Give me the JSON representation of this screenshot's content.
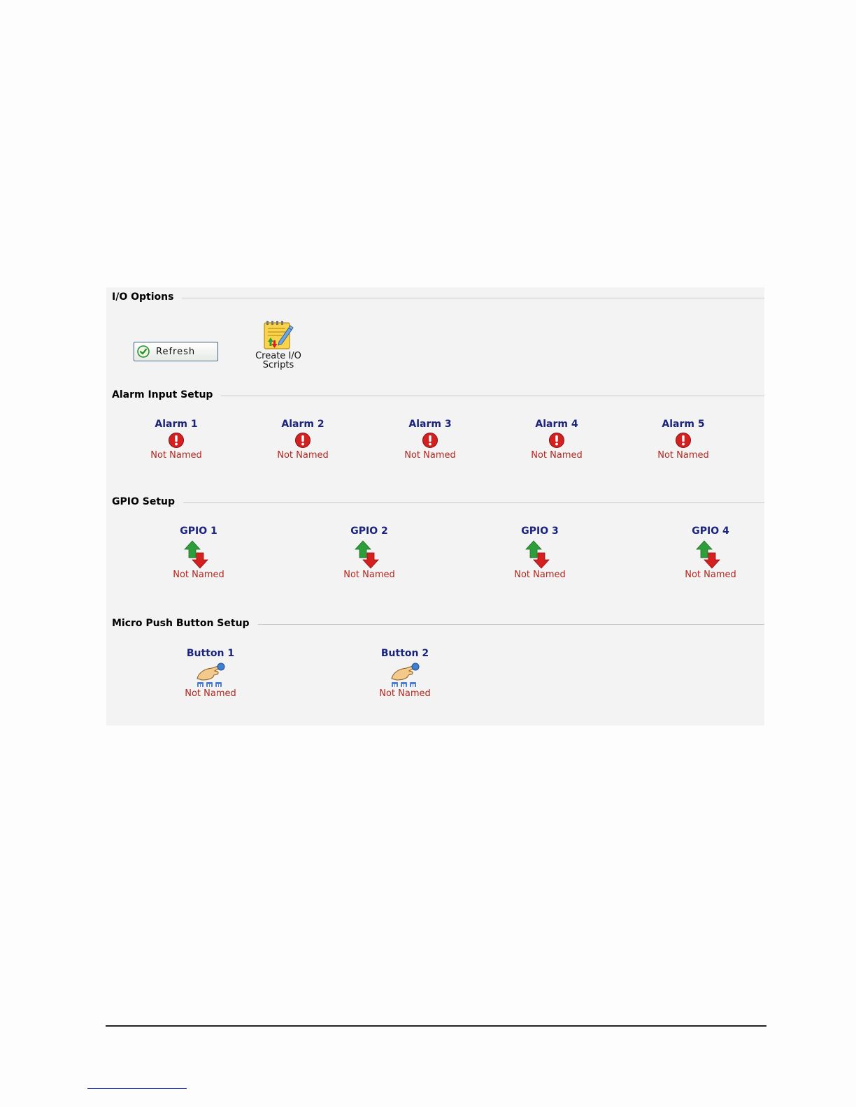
{
  "io_options": {
    "title": "I/O Options",
    "refresh_label": "Refresh",
    "create_scripts_line1": "Create I/O",
    "create_scripts_line2": "Scripts"
  },
  "alarm_input": {
    "title": "Alarm Input Setup",
    "items": [
      {
        "name": "Alarm 1",
        "status": "Not Named"
      },
      {
        "name": "Alarm 2",
        "status": "Not Named"
      },
      {
        "name": "Alarm 3",
        "status": "Not Named"
      },
      {
        "name": "Alarm 4",
        "status": "Not Named"
      },
      {
        "name": "Alarm 5",
        "status": "Not Named"
      }
    ]
  },
  "gpio": {
    "title": "GPIO Setup",
    "items": [
      {
        "name": "GPIO 1",
        "status": "Not Named"
      },
      {
        "name": "GPIO 2",
        "status": "Not Named"
      },
      {
        "name": "GPIO 3",
        "status": "Not Named"
      },
      {
        "name": "GPIO 4",
        "status": "Not Named"
      }
    ]
  },
  "push_button": {
    "title": "Micro Push Button Setup",
    "items": [
      {
        "name": "Button 1",
        "status": "Not Named"
      },
      {
        "name": "Button 2",
        "status": "Not Named"
      }
    ]
  },
  "colors": {
    "item_name": "#1a237e",
    "status_text": "#b3261e",
    "panel_bg": "#f3f3f3",
    "alarm_icon": "#d32020",
    "arrow_up": "#2e9e3a",
    "arrow_down": "#d62020"
  },
  "icons": {
    "refresh": "check-circle-icon",
    "create_scripts": "script-notepad-icon",
    "alarm": "alert-exclamation-icon",
    "gpio": "up-down-arrows-icon",
    "button": "pointing-hand-icon"
  }
}
